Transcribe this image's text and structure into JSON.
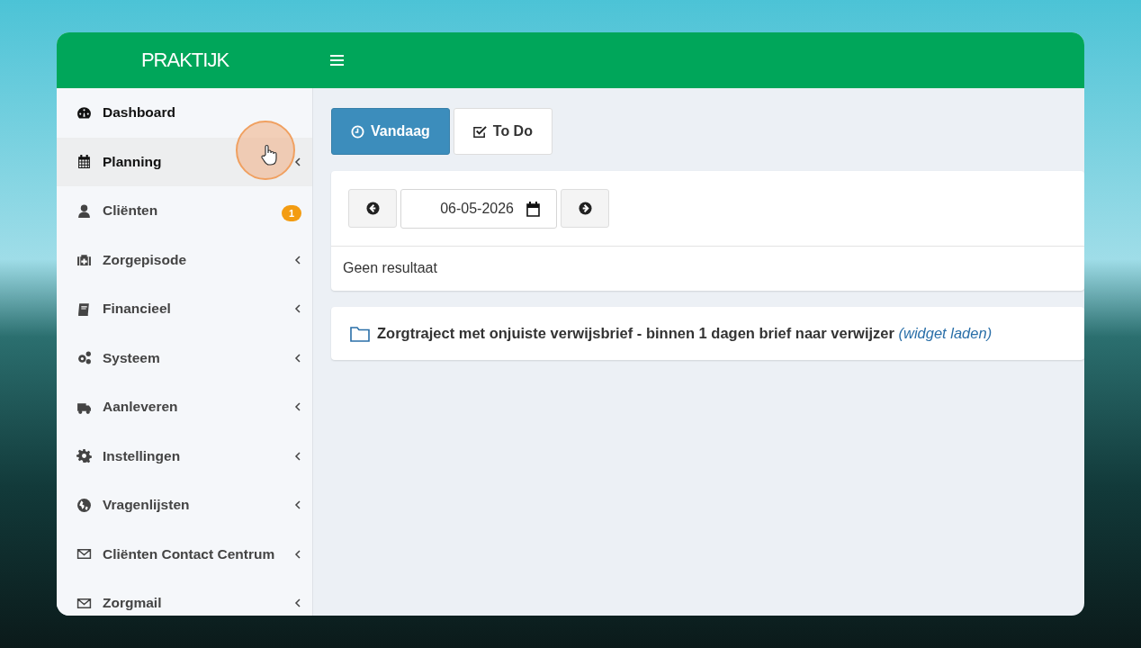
{
  "header": {
    "logo": "PRAKTIJK"
  },
  "sidebar": {
    "items": [
      {
        "label": "Dashboard",
        "active": true,
        "hovered": false,
        "expandable": false
      },
      {
        "label": "Planning",
        "active": true,
        "hovered": true,
        "expandable": true
      },
      {
        "label": "Cliënten",
        "active": false,
        "hovered": false,
        "expandable": false,
        "badge": "1"
      },
      {
        "label": "Zorgepisode",
        "active": false,
        "hovered": false,
        "expandable": true
      },
      {
        "label": "Financieel",
        "active": false,
        "hovered": false,
        "expandable": true
      },
      {
        "label": "Systeem",
        "active": false,
        "hovered": false,
        "expandable": true
      },
      {
        "label": "Aanleveren",
        "active": false,
        "hovered": false,
        "expandable": true
      },
      {
        "label": "Instellingen",
        "active": false,
        "hovered": false,
        "expandable": true
      },
      {
        "label": "Vragenlijsten",
        "active": false,
        "hovered": false,
        "expandable": true
      },
      {
        "label": "Cliënten Contact Centrum",
        "active": false,
        "hovered": false,
        "expandable": true
      },
      {
        "label": "Zorgmail",
        "active": false,
        "hovered": false,
        "expandable": true
      }
    ]
  },
  "tabs": [
    {
      "label": "Vandaag",
      "selected": true
    },
    {
      "label": "To Do",
      "selected": false
    }
  ],
  "date_nav": {
    "date": "06-05-2026",
    "message": "Geen resultaat"
  },
  "widget": {
    "title": "Zorgtraject met onjuiste verwijsbrief - binnen 1 dagen brief naar verwijzer",
    "link": "(widget laden)"
  }
}
